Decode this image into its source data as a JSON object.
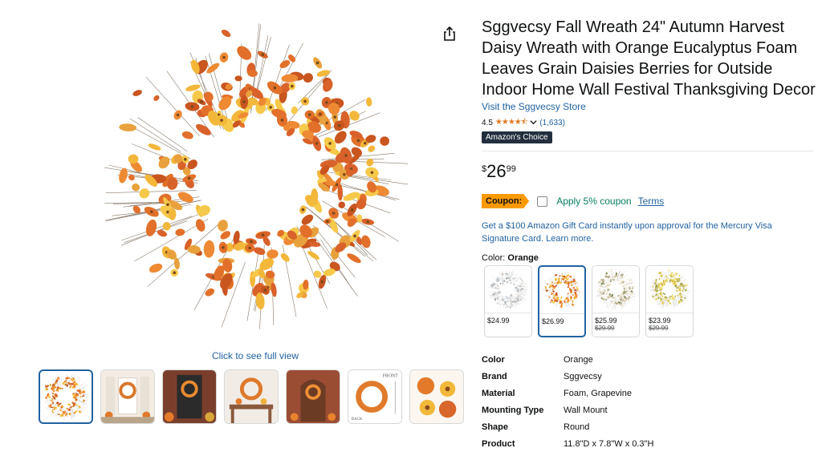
{
  "gallery": {
    "full_view_label": "Click to see full view",
    "thumbnails": [
      {
        "kind": "wreath-orange",
        "selected": true
      },
      {
        "kind": "porch-scene",
        "selected": false
      },
      {
        "kind": "door-scene-dark",
        "selected": false
      },
      {
        "kind": "wreath-on-wall",
        "selected": false
      },
      {
        "kind": "brick-door-scene",
        "selected": false
      },
      {
        "kind": "dimension-diagram",
        "selected": false
      },
      {
        "kind": "closeup-flowers",
        "selected": false
      }
    ],
    "diagram_labels": {
      "front": "FRONT",
      "back": "BACK"
    }
  },
  "share_icon": "share-icon",
  "product": {
    "title": "Sggvecsy Fall Wreath 24\" Autumn Harvest Daisy Wreath with Orange Eucalyptus Foam Leaves Grain Daisies Berries for Outside Indoor Home Wall Festival Thanksgiving Decor",
    "store_link": "Visit the Sggvecsy Store",
    "rating": "4.5",
    "stars": "★★★★⯪",
    "rating_count": "(1,633)",
    "badge": "Amazon's Choice",
    "price": {
      "symbol": "$",
      "whole": "26",
      "fraction": "99"
    },
    "coupon": {
      "tag": "Coupon:",
      "text": "Apply 5% coupon",
      "terms": "Terms"
    },
    "promo": "Get a $100 Amazon Gift Card instantly upon approval for the Mercury Visa Signature Card. Learn more.",
    "color_label": "Color:",
    "color_value": "Orange",
    "swatches": [
      {
        "price": "$24.99",
        "old": "",
        "selected": false,
        "tone": "white"
      },
      {
        "price": "$26.99",
        "old": "",
        "selected": true,
        "tone": "orange"
      },
      {
        "price": "$25.99",
        "old": "$29.99",
        "selected": false,
        "tone": "cream"
      },
      {
        "price": "$23.99",
        "old": "$29.99",
        "selected": false,
        "tone": "yellow"
      }
    ],
    "specs": [
      {
        "key": "Color",
        "value": "Orange"
      },
      {
        "key": "Brand",
        "value": "Sggvecsy"
      },
      {
        "key": "Material",
        "value": "Foam, Grapevine"
      },
      {
        "key": "Mounting Type",
        "value": "Wall Mount"
      },
      {
        "key": "Shape",
        "value": "Round"
      },
      {
        "key": "Product",
        "value": "11.8\"D x 7.8\"W x 0.3\"H"
      }
    ]
  },
  "colors": {
    "link": "#2162a1",
    "coupon_tag": "#ff9900",
    "star": "#de7921",
    "badge_bg": "#232f3e",
    "coupon_text": "#067d62"
  }
}
